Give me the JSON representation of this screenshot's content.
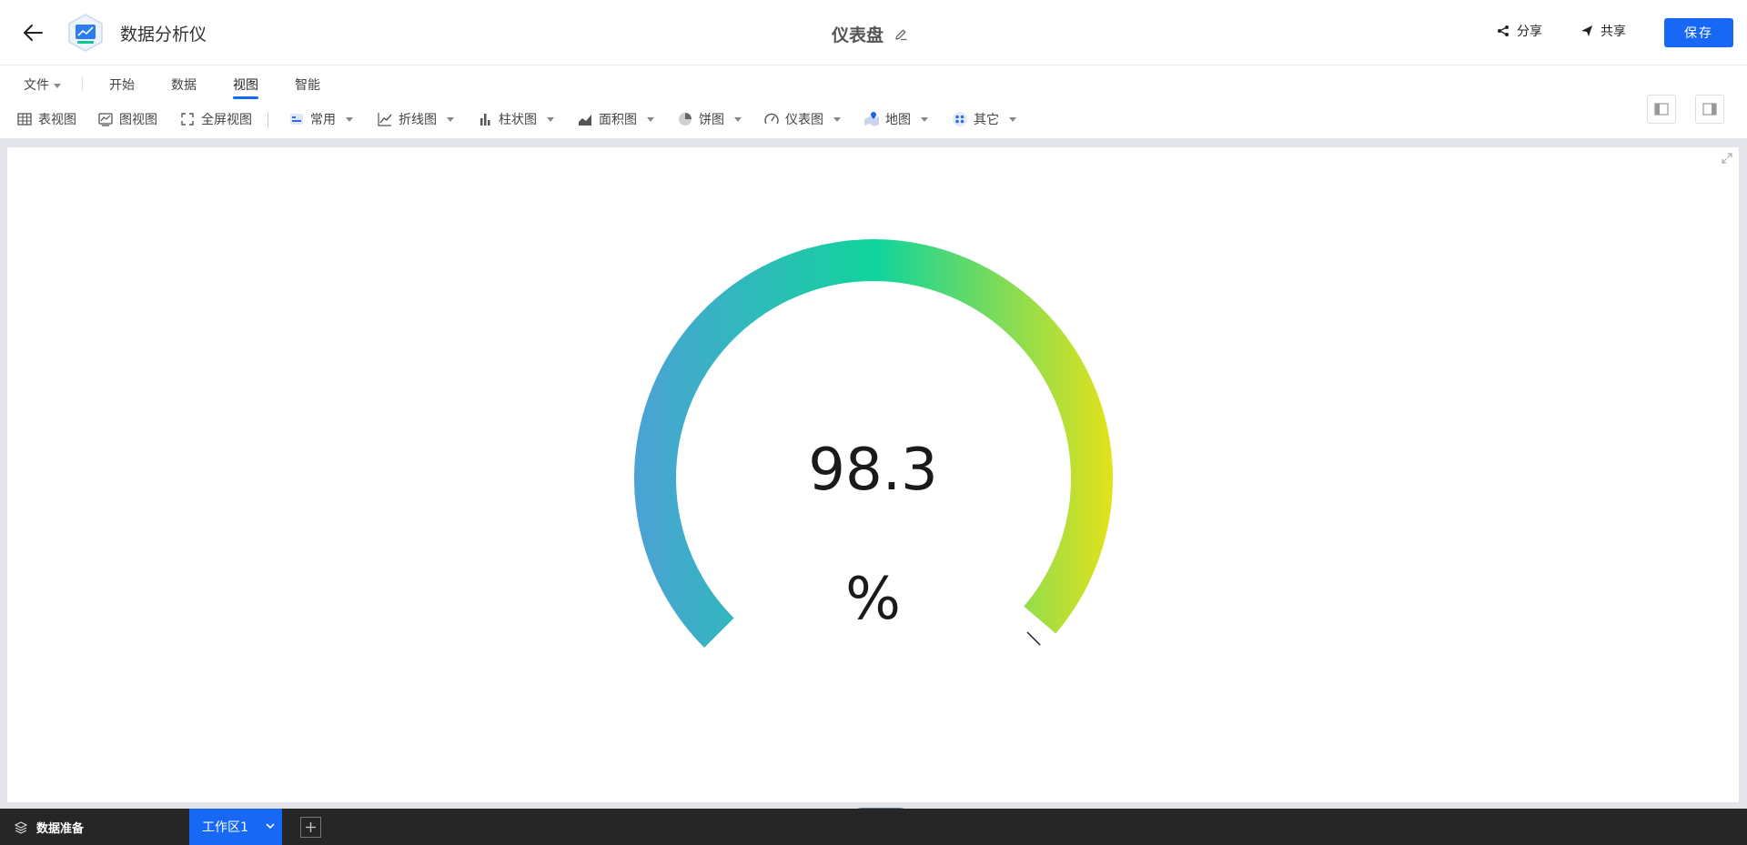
{
  "header": {
    "app_name": "数据分析仪",
    "doc_title": "仪表盘",
    "share_label": "分享",
    "collab_label": "共享",
    "save_label": "保存"
  },
  "menu": {
    "items": [
      {
        "label": "文件"
      },
      {
        "label": "开始"
      },
      {
        "label": "数据"
      },
      {
        "label": "视图"
      },
      {
        "label": "智能"
      }
    ],
    "active": "视图"
  },
  "toolbar": {
    "items": [
      {
        "label": "表视图",
        "icon": "table-icon"
      },
      {
        "label": "图视图",
        "icon": "chart-view-icon"
      },
      {
        "label": "全屏视图",
        "icon": "fullscreen-icon"
      },
      {
        "label": "常用",
        "icon": "common-icon"
      },
      {
        "label": "折线图",
        "icon": "line-chart-icon"
      },
      {
        "label": "柱状图",
        "icon": "bar-chart-icon"
      },
      {
        "label": "面积图",
        "icon": "area-chart-icon"
      },
      {
        "label": "饼图",
        "icon": "pie-chart-icon"
      },
      {
        "label": "仪表图",
        "icon": "gauge-icon"
      },
      {
        "label": "地图",
        "icon": "map-icon"
      },
      {
        "label": "其它",
        "icon": "other-icon"
      }
    ]
  },
  "gauge": {
    "value": "98.3",
    "unit": "%",
    "fraction": 0.983,
    "colors": {
      "start": "#4aa3d4",
      "mid": "#10d49c",
      "end": "#e3e21a"
    }
  },
  "bottom": {
    "prep_label": "数据准备",
    "workspace_label": "工作区1"
  },
  "colors": {
    "accent": "#1668f5",
    "bottom_bar": "#262626",
    "canvas_bg": "#e4e5ea"
  }
}
